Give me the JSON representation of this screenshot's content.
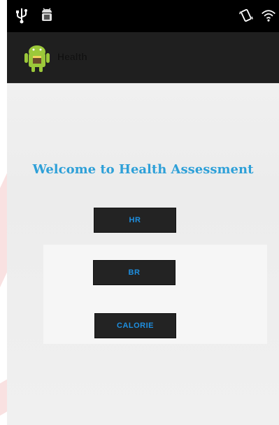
{
  "status_bar": {
    "left_icons": [
      "usb-icon",
      "android-debug-icon"
    ],
    "right_icons": [
      "vibrate-icon",
      "wifi-icon"
    ]
  },
  "action_bar": {
    "app_icon": "android-app-icon",
    "title": "Health"
  },
  "main": {
    "welcome": "Welcome to Health Assessment",
    "buttons": {
      "hr": "HR",
      "br": "BR",
      "calorie": "CALORIE"
    }
  },
  "colors": {
    "accent": "#2ea0d8",
    "button_bg": "#232323",
    "button_text": "#1e8fe0",
    "status_bar": "#000000",
    "action_bar": "#1f1f1f"
  }
}
